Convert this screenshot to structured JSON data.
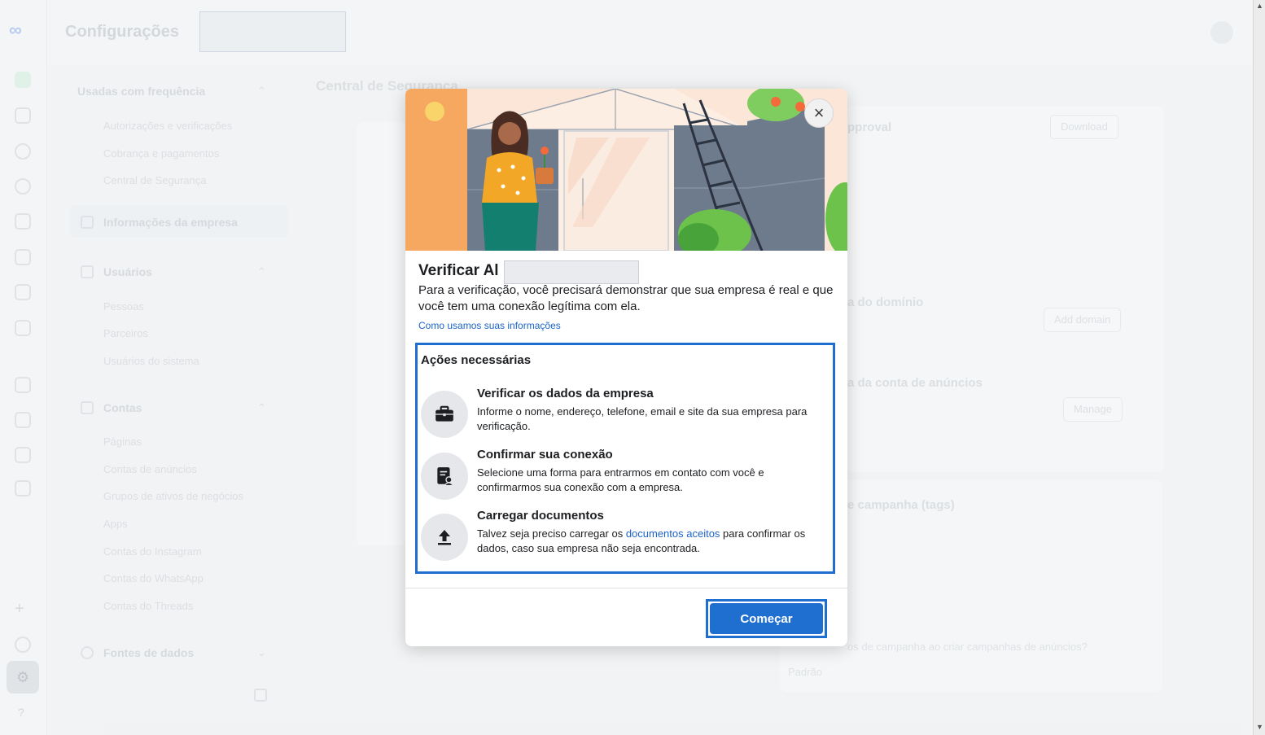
{
  "app": {
    "title": "Configurações",
    "section_title": "Central de Segurança"
  },
  "sidebar": {
    "groups": [
      {
        "label": "Usadas com frequência",
        "items": [
          "Autorizações e verificações",
          "Cobrança e pagamentos",
          "Central de Segurança"
        ]
      },
      {
        "label": "Informações da empresa",
        "items": []
      },
      {
        "label": "Usuários",
        "items": [
          "Pessoas",
          "Parceiros",
          "Usuários do sistema"
        ]
      },
      {
        "label": "Contas",
        "items": [
          "Páginas",
          "Contas de anúncios",
          "Grupos de ativos de negócios",
          "Apps",
          "Contas do Instagram",
          "Contas do WhatsApp",
          "Contas do Threads"
        ]
      },
      {
        "label": "Fontes de dados",
        "items": []
      }
    ]
  },
  "background": {
    "approval_title": "pproval",
    "download_label": "Download",
    "add_domain_label": "Add domain",
    "manage_label": "Manage",
    "domain_heading": "a do domínio",
    "ad_account_heading": "a da conta de anúncios",
    "tags_heading": "e campanha (tags)",
    "tags_question": "os de campanha ao criar campanhas de anúncios?",
    "select_value": "Padrão"
  },
  "modal": {
    "title": "Verificar Al",
    "description": "Para a verificação, você precisará demonstrar que sua empresa é real e que você tem uma conexão legítima com ela.",
    "info_link": "Como usamos suas informações",
    "actions_heading": "Ações necessárias",
    "steps": [
      {
        "icon": "briefcase-icon",
        "title": "Verificar os dados da empresa",
        "text": "Informe o nome, endereço, telefone, email e site da sua empresa para verificação."
      },
      {
        "icon": "contact-document-icon",
        "title": "Confirmar sua conexão",
        "text": "Selecione uma forma para entrarmos em contato com você e confirmarmos sua conexão com a empresa."
      },
      {
        "icon": "upload-icon",
        "title": "Carregar documentos",
        "text_before": "Talvez seja preciso carregar os ",
        "link": "documentos aceitos",
        "text_after": " para confirmar os dados, caso sua empresa não seja encontrada."
      }
    ],
    "start_label": "Começar",
    "close_icon": "×"
  },
  "colors": {
    "accent": "#1f6fd1",
    "link": "#1b64c9"
  }
}
